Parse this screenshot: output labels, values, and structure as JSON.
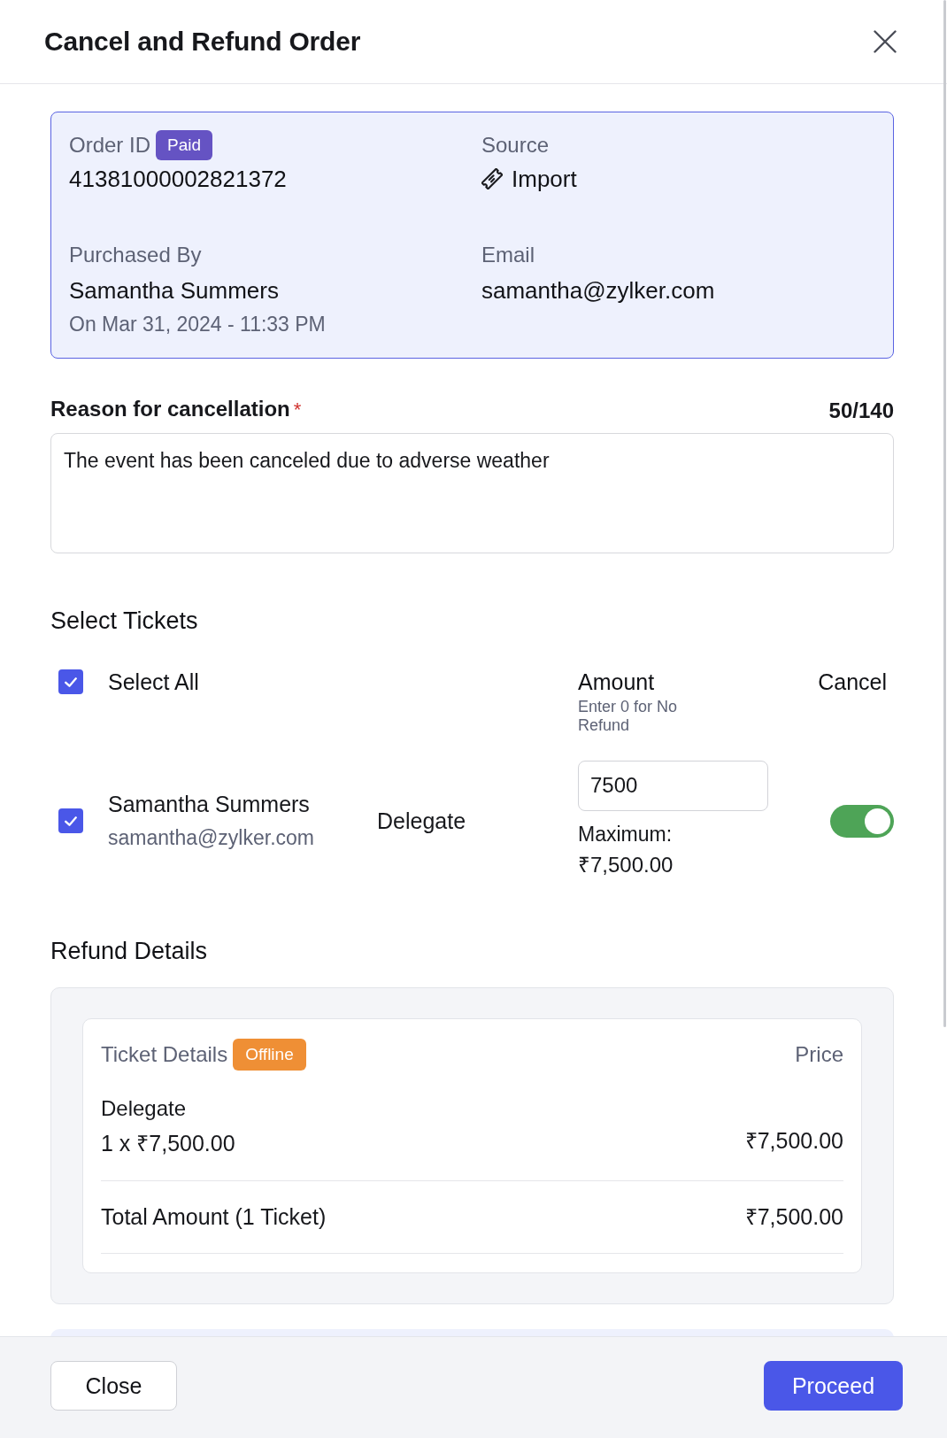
{
  "dialog": {
    "title": "Cancel and Refund Order"
  },
  "order_summary": {
    "order_id": {
      "label": "Order ID",
      "badge": "Paid",
      "value": "41381000002821372"
    },
    "source": {
      "label": "Source",
      "value": "Import"
    },
    "purchased_by": {
      "label": "Purchased By",
      "name": "Samantha Summers",
      "date": "On Mar 31, 2024 - 11:33 PM"
    },
    "email": {
      "label": "Email",
      "value": "samantha@zylker.com"
    }
  },
  "reason": {
    "label": "Reason for cancellation",
    "required_mark": "*",
    "counter": "50/140",
    "value": "The event has been canceled due to adverse weather"
  },
  "select_tickets": {
    "title": "Select Tickets",
    "select_all": {
      "label": "Select All",
      "checked": true
    },
    "amount_header": "Amount",
    "amount_hint": "Enter 0 for No Refund",
    "cancel_header": "Cancel",
    "tickets": [
      {
        "name": "Samantha Summers",
        "email": "samantha@zylker.com",
        "type": "Delegate",
        "checked": true,
        "amount": "7500",
        "maximum_label": "Maximum:",
        "maximum_value": "₹7,500.00",
        "cancel": true
      }
    ]
  },
  "refund_details": {
    "title": "Refund Details",
    "header": "Ticket Details",
    "badge": "Offline",
    "price_header": "Price",
    "items": [
      {
        "name": "Delegate",
        "quantity_price": "1 x ₹7,500.00",
        "price": "₹7,500.00"
      }
    ],
    "total": {
      "label": "Total Amount (1 Ticket)",
      "value": "₹7,500.00"
    }
  },
  "footer": {
    "buttons": [
      {
        "label": "Close",
        "kind": "secondary"
      },
      {
        "label": "Proceed",
        "kind": "primary"
      }
    ]
  }
}
